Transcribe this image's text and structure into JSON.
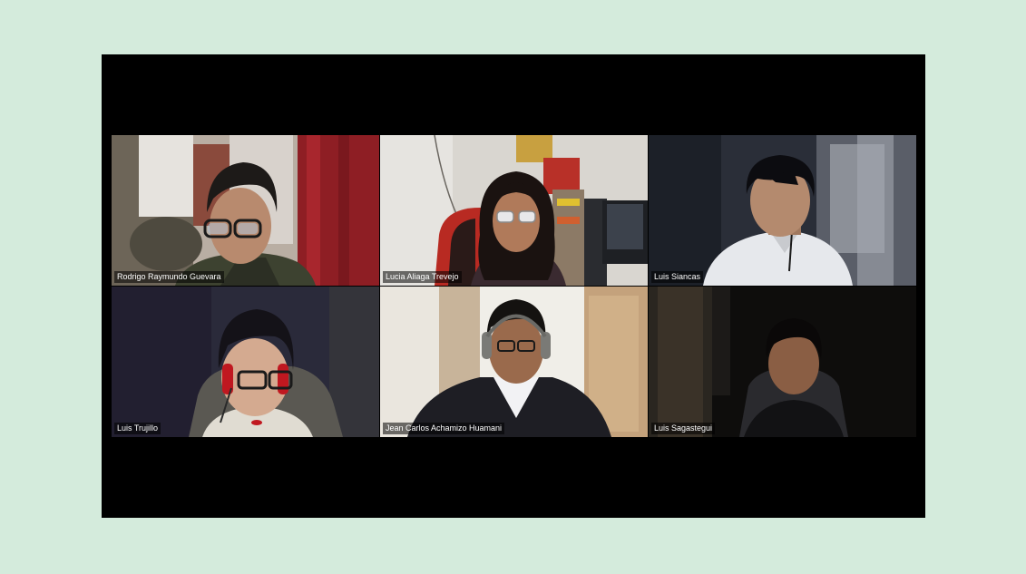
{
  "meeting": {
    "participants": [
      {
        "name": "Rodrigo Raymundo Guevara"
      },
      {
        "name": "Lucia Aliaga Trevejo"
      },
      {
        "name": "Luis Siancas"
      },
      {
        "name": "Luis Trujillo"
      },
      {
        "name": "Jean Carlos Achamizo Huamani"
      },
      {
        "name": "Luis Sagastegui"
      }
    ]
  },
  "colors": {
    "page_background": "#d4ebdc",
    "window_background": "#000000",
    "label_text": "#ffffff"
  }
}
